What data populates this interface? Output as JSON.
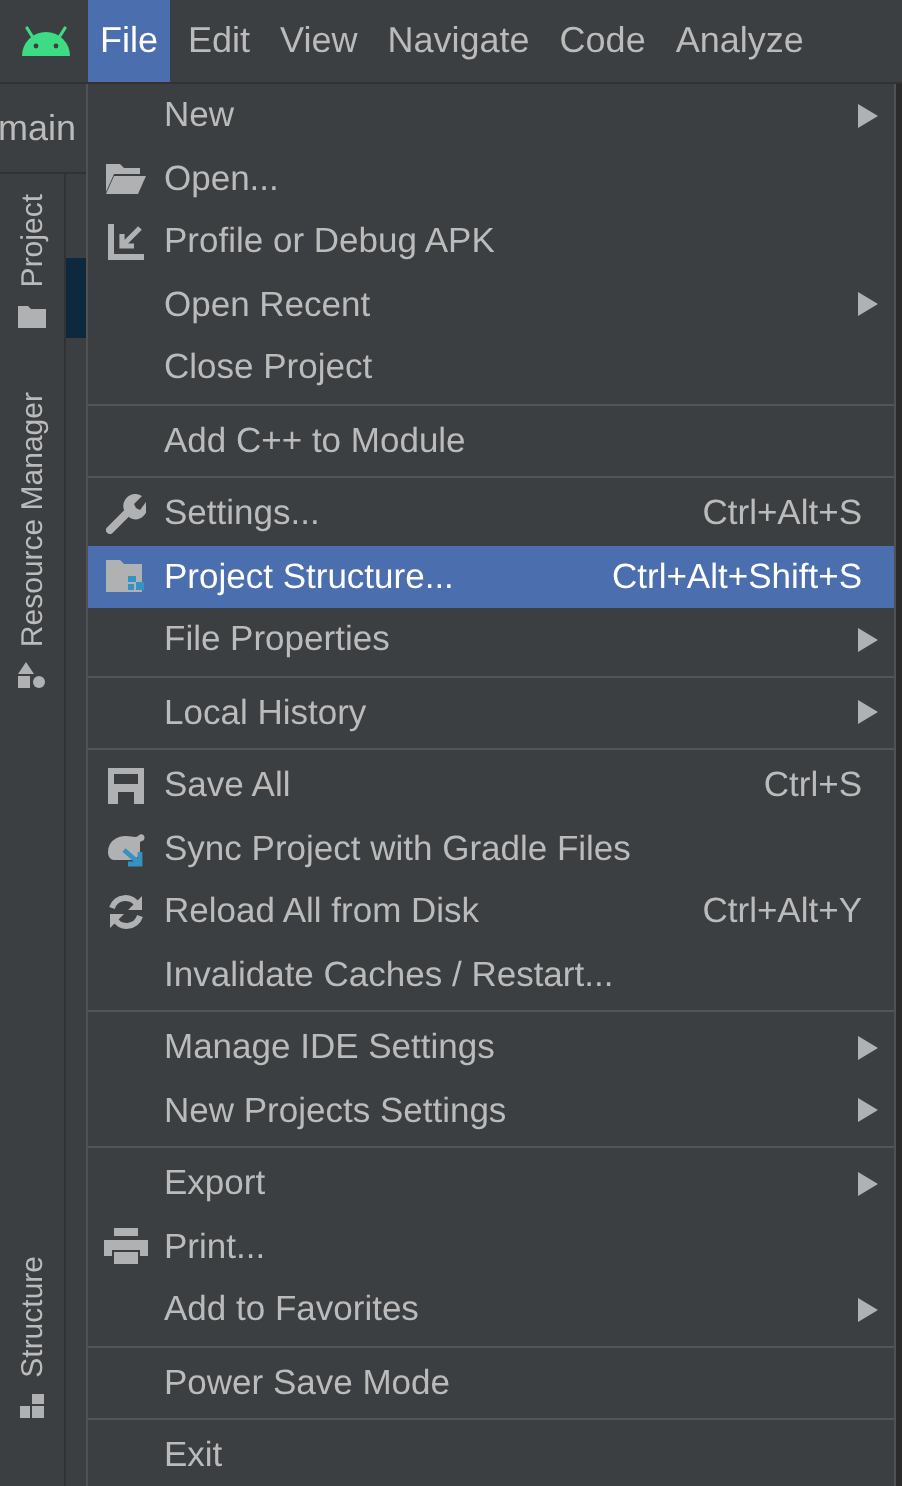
{
  "menu_bar": [
    {
      "label": "File",
      "selected": true
    },
    {
      "label": "Edit",
      "selected": false
    },
    {
      "label": "View",
      "selected": false
    },
    {
      "label": "Navigate",
      "selected": false
    },
    {
      "label": "Code",
      "selected": false
    },
    {
      "label": "Analyze",
      "selected": false
    }
  ],
  "editor_tab": {
    "label": "main"
  },
  "tool_stripe": [
    {
      "label": "Project"
    },
    {
      "label": "Resource Manager"
    },
    {
      "label": "Structure"
    }
  ],
  "file_menu": {
    "groups": [
      [
        {
          "label": "New",
          "has_submenu": true,
          "selected": false
        },
        {
          "label": "Open...",
          "has_submenu": false,
          "selected": false
        },
        {
          "label": "Profile or Debug APK",
          "has_submenu": false,
          "selected": false
        },
        {
          "label": "Open Recent",
          "has_submenu": true,
          "selected": false
        },
        {
          "label": "Close Project",
          "has_submenu": false,
          "selected": false
        }
      ],
      [
        {
          "label": "Add C++ to Module",
          "has_submenu": false,
          "selected": false
        }
      ],
      [
        {
          "label": "Settings...",
          "shortcut": "Ctrl+Alt+S",
          "has_submenu": false,
          "selected": false
        },
        {
          "label": "Project Structure...",
          "shortcut": "Ctrl+Alt+Shift+S",
          "has_submenu": false,
          "selected": true
        },
        {
          "label": "File Properties",
          "has_submenu": true,
          "selected": false
        }
      ],
      [
        {
          "label": "Local History",
          "has_submenu": true,
          "selected": false
        }
      ],
      [
        {
          "label": "Save All",
          "shortcut": "Ctrl+S",
          "has_submenu": false,
          "selected": false
        },
        {
          "label": "Sync Project with Gradle Files",
          "has_submenu": false,
          "selected": false
        },
        {
          "label": "Reload All from Disk",
          "shortcut": "Ctrl+Alt+Y",
          "has_submenu": false,
          "selected": false
        },
        {
          "label": "Invalidate Caches / Restart...",
          "has_submenu": false,
          "selected": false
        }
      ],
      [
        {
          "label": "Manage IDE Settings",
          "has_submenu": true,
          "selected": false
        },
        {
          "label": "New Projects Settings",
          "has_submenu": true,
          "selected": false
        }
      ],
      [
        {
          "label": "Export",
          "has_submenu": true,
          "selected": false
        },
        {
          "label": "Print...",
          "has_submenu": false,
          "selected": false
        },
        {
          "label": "Add to Favorites",
          "has_submenu": true,
          "selected": false
        }
      ],
      [
        {
          "label": "Power Save Mode",
          "has_submenu": false,
          "selected": false
        }
      ],
      [
        {
          "label": "Exit",
          "has_submenu": false,
          "selected": false
        }
      ]
    ]
  }
}
